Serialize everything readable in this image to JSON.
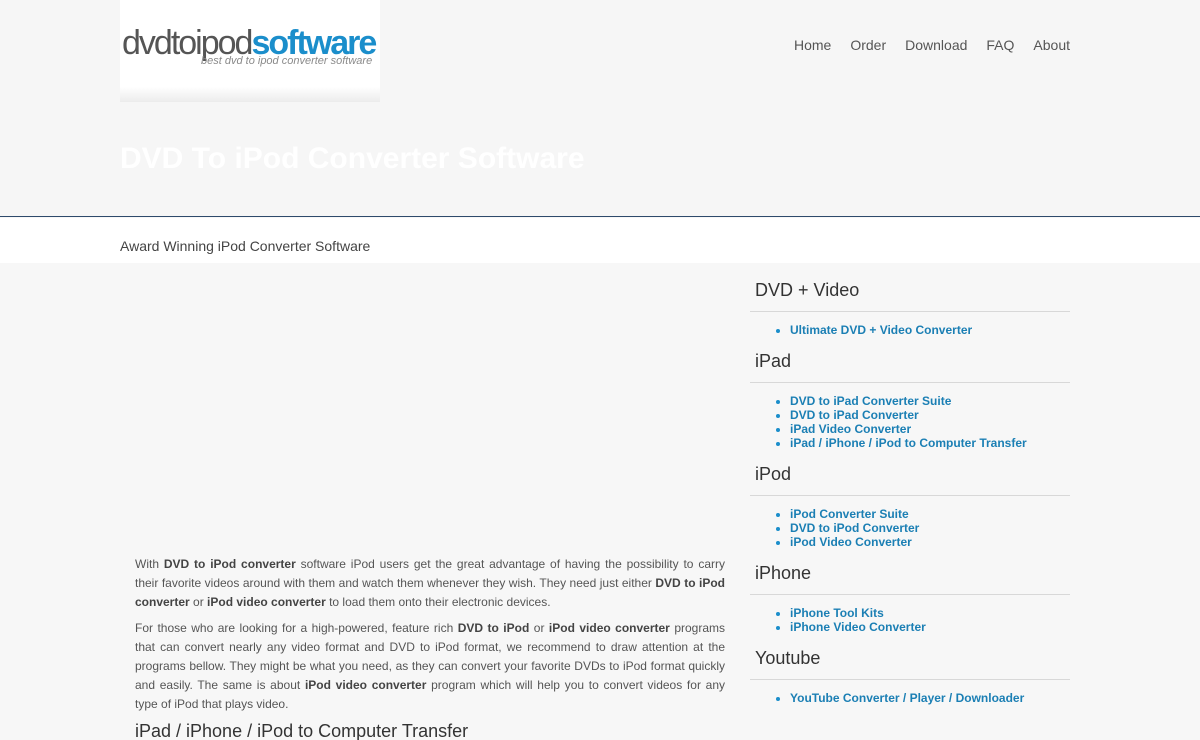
{
  "header": {
    "logo": {
      "part1": "dvdtoipod",
      "part2": "software",
      "tagline": "best dvd to ipod converter software"
    },
    "nav": [
      "Home",
      "Order",
      "Download",
      "FAQ",
      "About"
    ],
    "hero_title": "DVD To iPod Converter Software"
  },
  "subbar": {
    "text": "Award Winning iPod Converter Software"
  },
  "main": {
    "p1": {
      "t1": "With ",
      "b1": "DVD to iPod converter",
      "t2": " software iPod users get the great advantage of having the possibility to carry their favorite videos around with them and watch them whenever they wish. They need just either ",
      "b2": "DVD to iPod converter",
      "t3": " or ",
      "b3": "iPod video converter",
      "t4": " to load them onto their electronic devices."
    },
    "p2": {
      "t1": "For those who are looking for a high-powered, feature rich ",
      "b1": "DVD to iPod",
      "t2": " or ",
      "b2": "iPod video converter",
      "t3": " programs that can convert nearly any video format and DVD to iPod format, we recommend to draw attention at the programs bellow. They might be what you need, as they can convert your favorite DVDs to iPod format quickly and easily. The same is about ",
      "b3": "iPod video converter",
      "t4": " program which will help you to convert videos for any type of iPod that plays video."
    },
    "heading": "iPad / iPhone / iPod to Computer Transfer"
  },
  "sidebar": {
    "sections": [
      {
        "title": "DVD + Video",
        "links": [
          "Ultimate DVD + Video Converter"
        ]
      },
      {
        "title": "iPad",
        "links": [
          "DVD to iPad Converter Suite",
          "DVD to iPad Converter",
          "iPad Video Converter",
          "iPad / iPhone / iPod to Computer Transfer"
        ]
      },
      {
        "title": "iPod",
        "links": [
          "iPod Converter Suite",
          "DVD to iPod Converter",
          "iPod Video Converter"
        ]
      },
      {
        "title": "iPhone",
        "links": [
          "iPhone Tool Kits",
          "iPhone Video Converter"
        ]
      },
      {
        "title": "Youtube",
        "links": [
          "YouTube Converter / Player / Downloader"
        ]
      }
    ]
  }
}
